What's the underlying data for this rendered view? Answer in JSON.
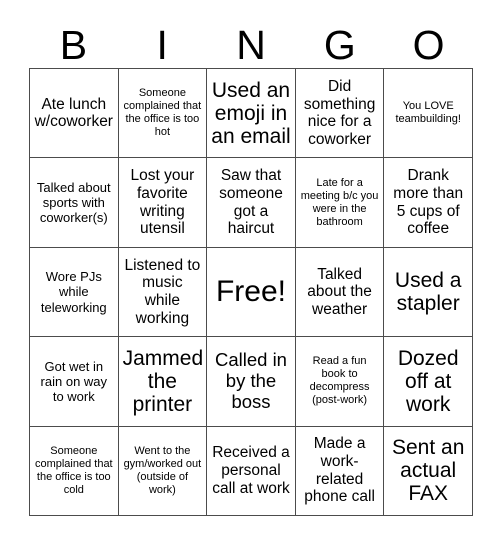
{
  "card": {
    "title": "BINGO",
    "header_letters": [
      "B",
      "I",
      "N",
      "G",
      "O"
    ],
    "colors": {
      "background": "#ffffff",
      "text": "#000000",
      "border": "#4c4c4c"
    },
    "grid_size": "5x5",
    "free_space_label": "Free!",
    "cells": [
      {
        "text": "Ate lunch w/coworker",
        "size": "md",
        "free": false
      },
      {
        "text": "Someone complained that the office is too hot",
        "size": "xs",
        "free": false
      },
      {
        "text": "Used an emoji in an email",
        "size": "xl",
        "free": false
      },
      {
        "text": "Did something nice for a coworker",
        "size": "md",
        "free": false
      },
      {
        "text": "You LOVE teambuilding!",
        "size": "xs",
        "free": false
      },
      {
        "text": "Talked about sports with coworker(s)",
        "size": "sm",
        "free": false
      },
      {
        "text": "Lost your favorite writing utensil",
        "size": "md",
        "free": false
      },
      {
        "text": "Saw that someone got a haircut",
        "size": "md",
        "free": false
      },
      {
        "text": "Late for a meeting b/c you were in the bathroom",
        "size": "xs",
        "free": false
      },
      {
        "text": "Drank more than 5 cups of coffee",
        "size": "md",
        "free": false
      },
      {
        "text": "Wore PJs while teleworking",
        "size": "sm",
        "free": false
      },
      {
        "text": "Listened to music while working",
        "size": "md",
        "free": false
      },
      {
        "text": "Free!",
        "size": "free",
        "free": true
      },
      {
        "text": "Talked about the weather",
        "size": "md",
        "free": false
      },
      {
        "text": "Used a stapler",
        "size": "xl",
        "free": false
      },
      {
        "text": "Got wet in rain on way to work",
        "size": "sm",
        "free": false
      },
      {
        "text": "Jammed the printer",
        "size": "xl",
        "free": false
      },
      {
        "text": "Called in by the boss",
        "size": "lg",
        "free": false
      },
      {
        "text": "Read a fun book to decompress (post-work)",
        "size": "xs",
        "free": false
      },
      {
        "text": "Dozed off at work",
        "size": "xl",
        "free": false
      },
      {
        "text": "Someone complained that the office is too cold",
        "size": "xs",
        "free": false
      },
      {
        "text": "Went to the gym/worked out (outside of work)",
        "size": "xs",
        "free": false
      },
      {
        "text": "Received a personal call at work",
        "size": "md",
        "free": false
      },
      {
        "text": "Made a work-related phone call",
        "size": "md",
        "free": false
      },
      {
        "text": "Sent an actual FAX",
        "size": "xl",
        "free": false
      }
    ]
  }
}
